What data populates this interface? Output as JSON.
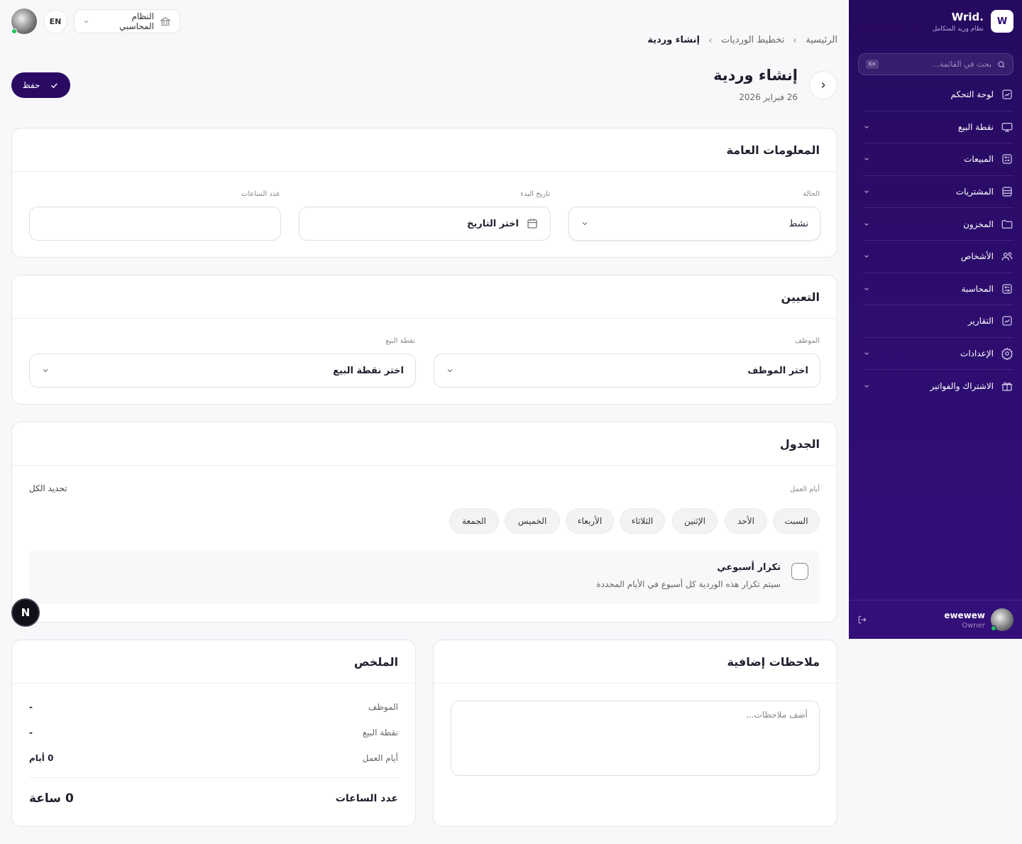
{
  "sidebar": {
    "brand_name": "Wrid.",
    "brand_subtitle": "نظام وريد المتكامل",
    "logo_letter": "W",
    "search_placeholder": "بحث في القائمة...",
    "search_shortcut": "⌘K",
    "items": [
      {
        "label": "لوحة التحكم",
        "icon": "dashboard-icon",
        "has_submenu": false
      },
      {
        "label": "نقطة البيع",
        "icon": "monitor-icon",
        "has_submenu": true
      },
      {
        "label": "المبيعات",
        "icon": "sales-icon",
        "has_submenu": true
      },
      {
        "label": "المشتريات",
        "icon": "purchases-icon",
        "has_submenu": true
      },
      {
        "label": "المخزون",
        "icon": "folder-icon",
        "has_submenu": true
      },
      {
        "label": "الأشخاص",
        "icon": "users-icon",
        "has_submenu": true
      },
      {
        "label": "المحاسبة",
        "icon": "calculator-icon",
        "has_submenu": true
      },
      {
        "label": "التقارير",
        "icon": "reports-icon",
        "has_submenu": false
      },
      {
        "label": "الإعدادات",
        "icon": "gear-icon",
        "has_submenu": true
      },
      {
        "label": "الاشتراك والفواتير",
        "icon": "gift-icon",
        "has_submenu": true
      }
    ],
    "user": {
      "name": "ewewew",
      "role": "Owner"
    }
  },
  "topbar": {
    "language": "EN",
    "system_selector": "النظام المحاسبي"
  },
  "breadcrumb": [
    "الرئيسية",
    "تخطيط الورديات",
    "إنشاء وردية"
  ],
  "header": {
    "title": "إنشاء وردية",
    "date": "26 فبراير 2026",
    "save_label": "حفظ"
  },
  "general": {
    "title": "المعلومات العامة",
    "status_label": "الحالة",
    "status_value": "نشط",
    "start_date_label": "تاريخ البدء",
    "start_date_placeholder": "اختر التاريخ",
    "hours_label": "عدد الساعات",
    "hours_value": ""
  },
  "assignment": {
    "title": "التعيين",
    "employee_label": "الموظف",
    "employee_placeholder": "اختر الموظف",
    "pos_label": "نقطة البيع",
    "pos_placeholder": "اختر نقطة البيع"
  },
  "schedule": {
    "title": "الجدول",
    "workdays_label": "أيام العمل",
    "select_all": "تحديد الكل",
    "days": [
      "السبت",
      "الأحد",
      "الإثنين",
      "الثلاثاء",
      "الأربعاء",
      "الخميس",
      "الجمعة"
    ],
    "recurring_title": "تكرار أسبوعي",
    "recurring_desc": "سيتم تكرار هذه الوردية كل أسبوع في الأيام المحددة",
    "recurring_checked": false
  },
  "notes": {
    "title": "ملاحظات إضافية",
    "placeholder": "أضف ملاحظات..."
  },
  "summary": {
    "title": "الملخص",
    "employee_label": "الموظف",
    "employee_value": "-",
    "pos_label": "نقطة البيع",
    "pos_value": "-",
    "workdays_label": "أيام العمل",
    "workdays_value": "0 أيام",
    "hours_label": "عدد الساعات",
    "hours_value": "0 ساعة"
  },
  "dev_badge": "N",
  "colors": {
    "sidebar_bg": "#2d0d6e",
    "primary": "#2a0a63",
    "online": "#22c55e"
  }
}
